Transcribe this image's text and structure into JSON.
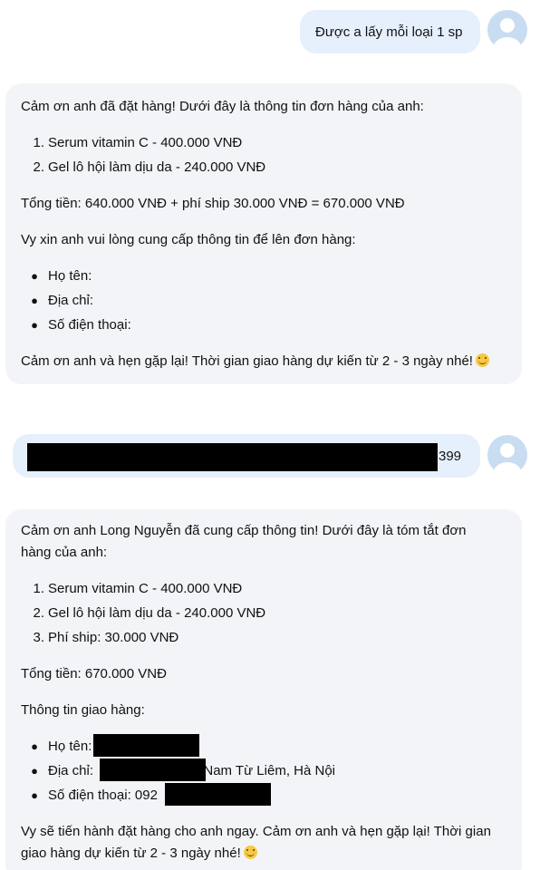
{
  "messages": {
    "user1": {
      "text": "Được a lấy mỗi loại 1 sp"
    },
    "bot1": {
      "intro": "Cảm ơn anh đã đặt hàng! Dưới đây là thông tin đơn hàng của anh:",
      "items": [
        {
          "num": "1.",
          "text": "Serum vitamin C - 400.000 VNĐ"
        },
        {
          "num": "2.",
          "text": "Gel lô hội làm dịu da - 240.000 VNĐ"
        }
      ],
      "total": "Tổng tiền: 640.000 VNĐ + phí ship 30.000 VNĐ = 670.000 VNĐ",
      "request": "Vy xin anh vui lòng cung cấp thông tin để lên đơn hàng:",
      "fields": [
        "Họ tên:",
        "Địa chỉ:",
        "Số điện thoại:"
      ],
      "closing": "Cảm ơn anh và hẹn gặp lại! Thời gian giao hàng dự kiến từ 2 - 3 ngày nhé!",
      "emoji": "smiling-face-emoji"
    },
    "user2": {
      "visible_suffix": "399"
    },
    "bot2": {
      "intro_line1": "Cảm ơn anh Long Nguyễn đã cung cấp thông tin! Dưới đây là tóm tắt đơn",
      "intro_line2": "hàng của anh:",
      "items": [
        {
          "num": "1.",
          "text": "Serum vitamin C - 400.000 VNĐ"
        },
        {
          "num": "2.",
          "text": "Gel lô hội làm dịu da - 240.000 VNĐ"
        },
        {
          "num": "3.",
          "text": "Phí ship: 30.000 VNĐ"
        }
      ],
      "total": "Tổng tiền: 670.000 VNĐ",
      "shipping_header": "Thông tin giao hàng:",
      "name_label": "Họ tên:",
      "address_label": "Địa chỉ:",
      "address_suffix": ", Nam Từ Liêm, Hà Nội",
      "phone_label": "Số điện thoại: 092",
      "closing_line1": "Vy sẽ tiến hành đặt hàng cho anh ngay. Cảm ơn anh và hẹn gặp lại! Thời gian",
      "closing_line2": "giao hàng dự kiến từ 2 - 3 ngày nhé!",
      "emoji": "smiling-face-emoji"
    }
  },
  "colors": {
    "user_bubble": "#e6f0fc",
    "bot_bubble": "#f3f4f7",
    "avatar": "#c8dcf2",
    "redaction": "#000000"
  }
}
